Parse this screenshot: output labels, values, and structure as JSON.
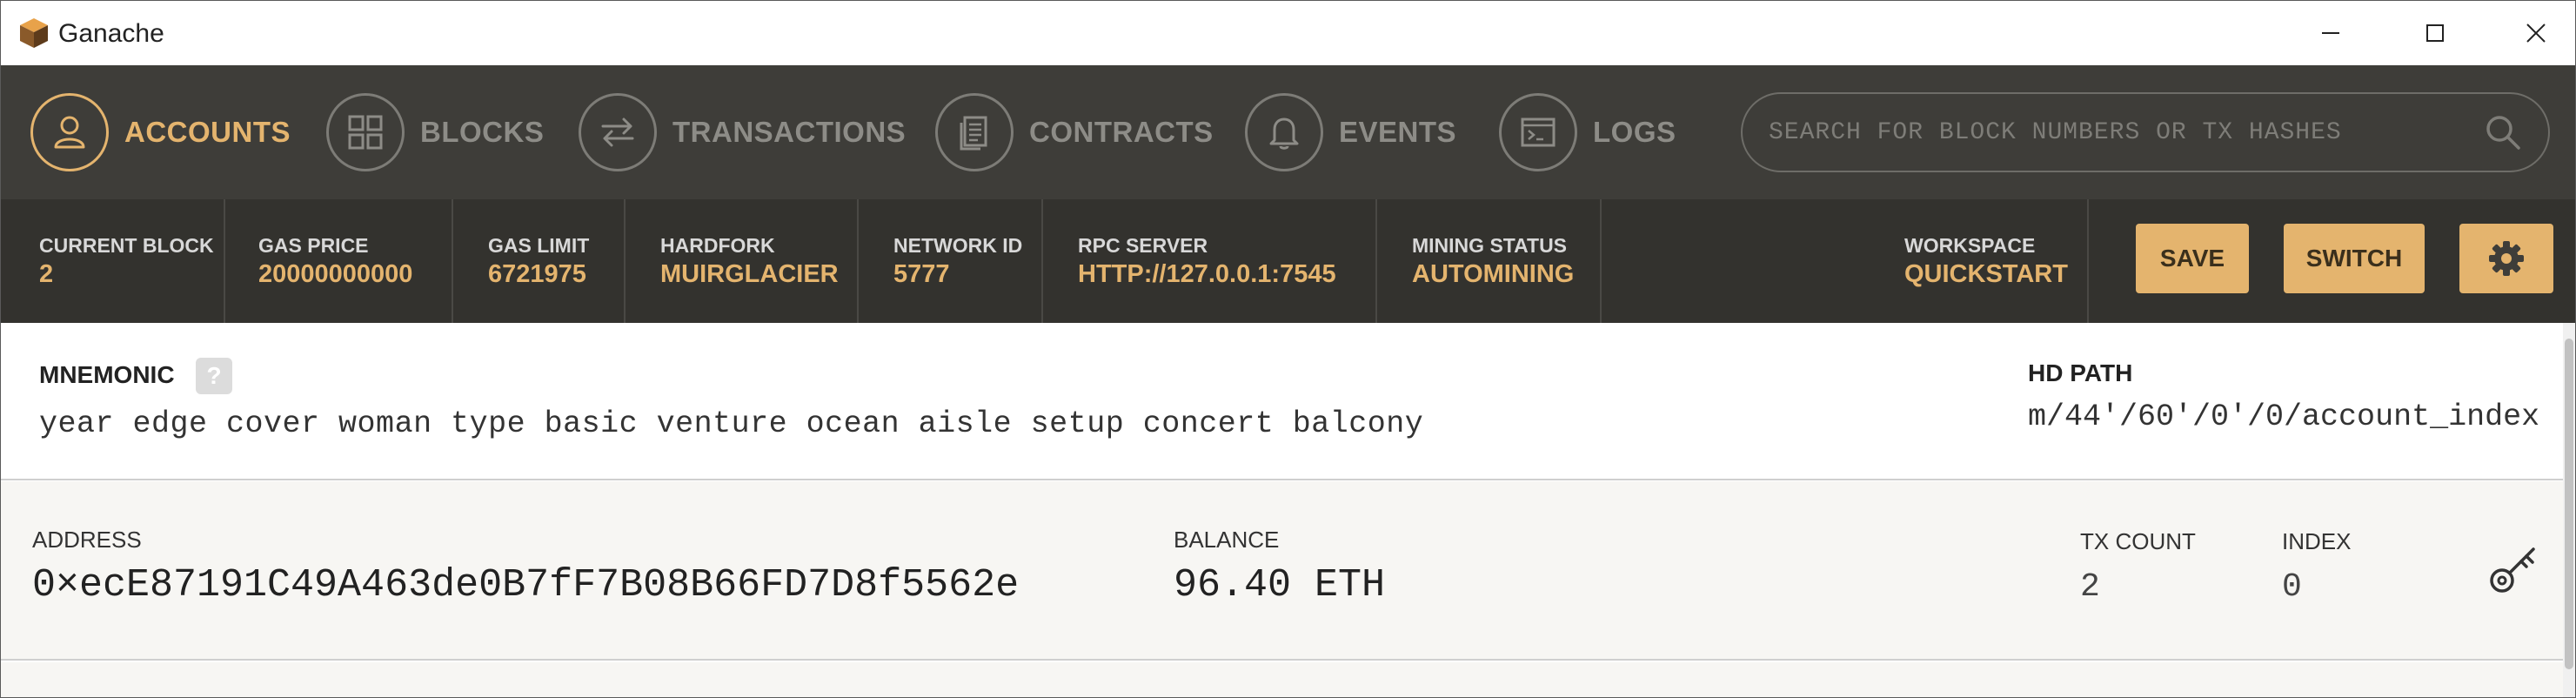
{
  "window": {
    "title": "Ganache"
  },
  "nav": {
    "items": [
      {
        "label": "ACCOUNTS",
        "icon": "user-icon",
        "active": true
      },
      {
        "label": "BLOCKS",
        "icon": "grid-icon",
        "active": false
      },
      {
        "label": "TRANSACTIONS",
        "icon": "swap-arrows-icon",
        "active": false
      },
      {
        "label": "CONTRACTS",
        "icon": "document-icon",
        "active": false
      },
      {
        "label": "EVENTS",
        "icon": "bell-icon",
        "active": false
      },
      {
        "label": "LOGS",
        "icon": "terminal-icon",
        "active": false
      }
    ],
    "search_placeholder": "SEARCH FOR BLOCK NUMBERS OR TX HASHES"
  },
  "status": {
    "current_block": {
      "label": "CURRENT BLOCK",
      "value": "2"
    },
    "gas_price": {
      "label": "GAS PRICE",
      "value": "20000000000"
    },
    "gas_limit": {
      "label": "GAS LIMIT",
      "value": "6721975"
    },
    "hardfork": {
      "label": "HARDFORK",
      "value": "MUIRGLACIER"
    },
    "network_id": {
      "label": "NETWORK ID",
      "value": "5777"
    },
    "rpc_server": {
      "label": "RPC SERVER",
      "value": "HTTP://127.0.0.1:7545"
    },
    "mining_status": {
      "label": "MINING STATUS",
      "value": "AUTOMINING"
    },
    "workspace": {
      "label": "WORKSPACE",
      "value": "QUICKSTART"
    },
    "save_label": "SAVE",
    "switch_label": "SWITCH"
  },
  "mnemonic": {
    "label": "MNEMONIC",
    "help": "?",
    "words": "year edge cover woman type basic venture ocean aisle setup concert balcony",
    "hd_path_label": "HD PATH",
    "hd_path": "m/44'/60'/0'/0/account_index"
  },
  "accounts": [
    {
      "address_label": "ADDRESS",
      "address": "0×ecE87191C49A463de0B7fF7B08B66FD7D8f5562e",
      "balance_label": "BALANCE",
      "balance": "96.40 ETH",
      "tx_count_label": "TX COUNT",
      "tx_count": "2",
      "index_label": "INDEX",
      "index": "0"
    }
  ],
  "colors": {
    "accent": "#e4b46e",
    "nav_bg": "#3e3d39",
    "status_bg": "#33322e",
    "inactive": "#8d8c87"
  }
}
